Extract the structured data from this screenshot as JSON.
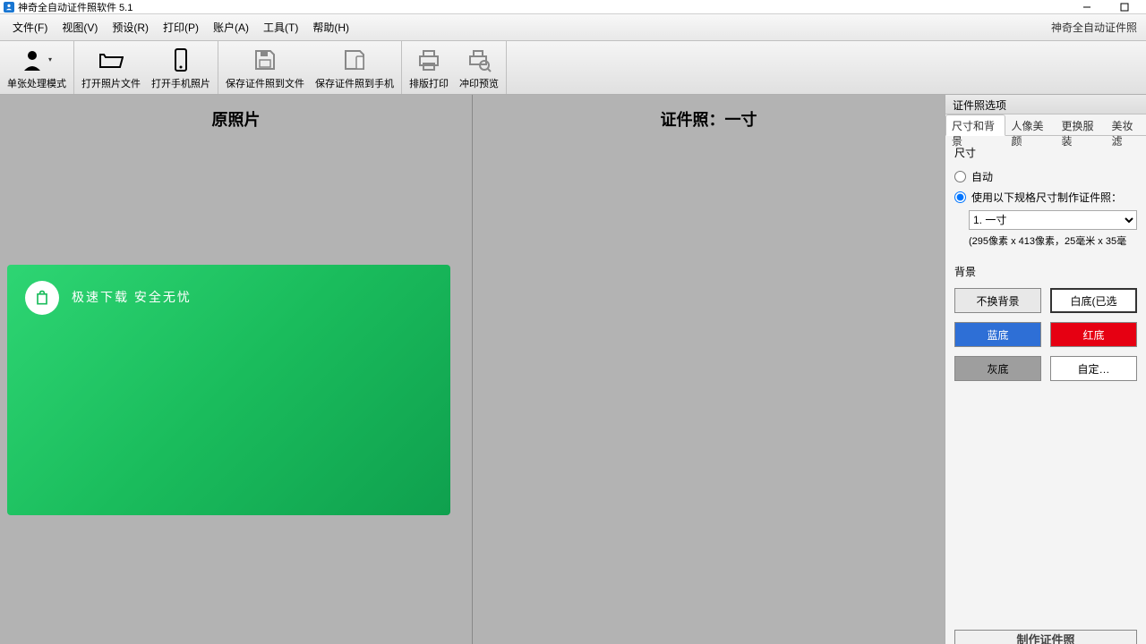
{
  "titlebar": {
    "app_title": "神奇全自动证件照软件 5.1"
  },
  "menubar": {
    "items": [
      {
        "label": "文件(F)"
      },
      {
        "label": "视图(V)"
      },
      {
        "label": "预设(R)"
      },
      {
        "label": "打印(P)"
      },
      {
        "label": "账户(A)"
      },
      {
        "label": "工具(T)"
      },
      {
        "label": "帮助(H)"
      }
    ],
    "brand": "神奇全自动证件照"
  },
  "toolbar": {
    "btn_mode": "单张处理模式",
    "btn_open_file": "打开照片文件",
    "btn_open_phone": "打开手机照片",
    "btn_save_file": "保存证件照到文件",
    "btn_save_phone": "保存证件照到手机",
    "btn_layout_print": "排版打印",
    "btn_print_preview": "冲印预览"
  },
  "canvas": {
    "left_title": "原照片",
    "right_title": "证件照：一寸"
  },
  "promo": {
    "text": "极速下载  安全无忧"
  },
  "panel": {
    "header": "证件照选项",
    "tabs": [
      {
        "label": "尺寸和背景"
      },
      {
        "label": "人像美颜"
      },
      {
        "label": "更换服装"
      },
      {
        "label": "美妆滤"
      }
    ],
    "size_section_title": "尺寸",
    "size_auto_label": "自动",
    "size_preset_label": "使用以下规格尺寸制作证件照：",
    "size_selected_option": "1. 一寸",
    "size_info": "(295像素 x 413像素，25毫米 x 35毫",
    "bg_section_title": "背景",
    "bg_buttons": {
      "no_change": "不换背景",
      "white": "白底(已选",
      "blue": "蓝底",
      "red": "红底",
      "gray": "灰底",
      "custom": "自定…"
    },
    "bottom_action": "制作证件照"
  }
}
